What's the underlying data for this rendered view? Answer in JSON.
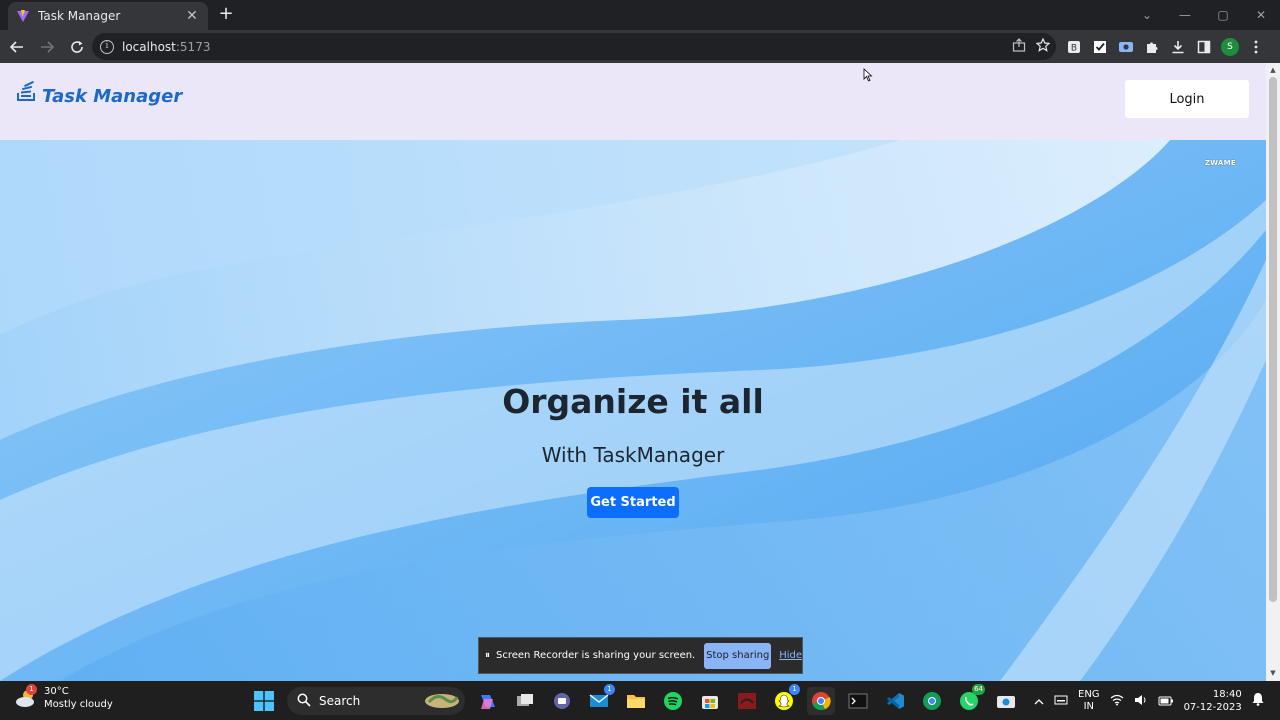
{
  "browser": {
    "tab_title": "Task Manager",
    "url_host": "localhost",
    "url_port": ":5173",
    "profile_initial": "S"
  },
  "page": {
    "brand": "Task Manager",
    "login_label": "Login",
    "corner_mark": "ZWAME",
    "hero_title": "Organize it all",
    "hero_subtitle": "With TaskManager",
    "cta_label": "Get Started"
  },
  "screen_share": {
    "message": "Screen Recorder is sharing your screen.",
    "stop_label": "Stop sharing",
    "hide_label": "Hide"
  },
  "taskbar": {
    "weather_temp": "30°C",
    "weather_desc": "Mostly cloudy",
    "weather_badge": "1",
    "search_label": "Search",
    "mail_badge": "1",
    "chat_badge": "1",
    "whatsapp_badge": "64",
    "lang_top": "ENG",
    "lang_bottom": "IN",
    "time": "18:40",
    "date": "07-12-2023"
  },
  "colors": {
    "brand": "#1b6ac9",
    "navbar_bg": "#ebe7f8",
    "cta_bg": "#0d6efd",
    "hero_bg": "#64b2f3"
  }
}
